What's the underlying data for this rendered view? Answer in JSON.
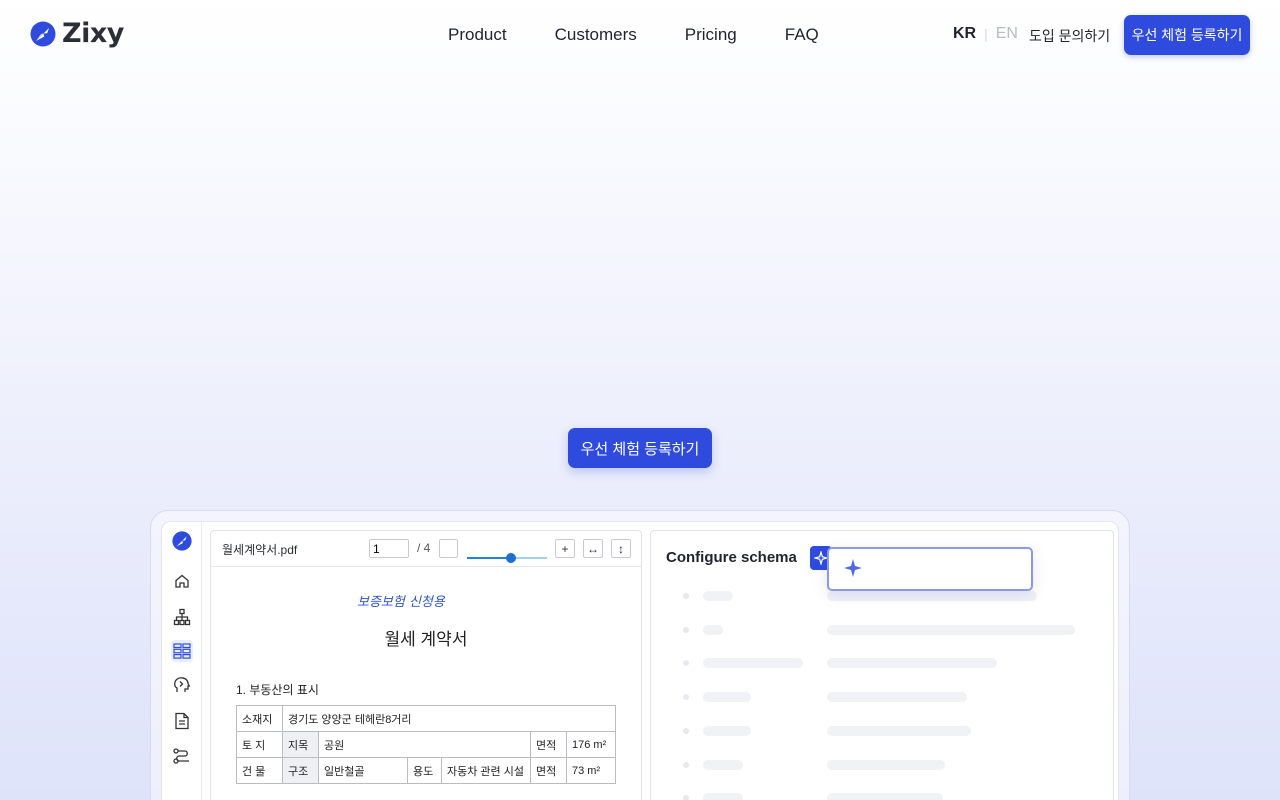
{
  "brand": {
    "name": "Zixy",
    "accent": "#2e4bde"
  },
  "nav": {
    "items": [
      "Product",
      "Customers",
      "Pricing",
      "FAQ"
    ],
    "lang_kr": "KR",
    "lang_en": "EN",
    "contact": "도입 문의하기",
    "cta": "우선 체험 등록하기"
  },
  "hero": {
    "cta": "우선 체험 등록하기"
  },
  "mockup": {
    "sidebar_icons": [
      "logo-icon",
      "home-icon",
      "sitemap-icon",
      "grid-icon",
      "brain-icon",
      "document-icon",
      "flow-icon"
    ],
    "viewer": {
      "filename": "월세계약서.pdf",
      "page_value": "1",
      "page_total": "/ 4",
      "zoom_fraction": 0.55,
      "plus": "+",
      "fit_width": "↔",
      "fit_height": "↕"
    },
    "document": {
      "stamp": "보증보험 신청용",
      "title": "월세 계약서",
      "section": "1. 부동산의 표시",
      "row1": {
        "label": "소재지",
        "value": "경기도 양양군 테헤란8거리"
      },
      "row2": {
        "label": "토 지",
        "c1": "지목",
        "c2": "공원",
        "c3": "면적",
        "c4": "176 m²"
      },
      "row3": {
        "label": "건 물",
        "c1": "구조",
        "c2": "일반철골",
        "c3": "용도",
        "c4": "자동차 관련 시설",
        "c5": "면적",
        "c6": "73 m²"
      }
    },
    "schema": {
      "title": "Configure schema",
      "ai_icon": "sparkle-icon"
    }
  }
}
